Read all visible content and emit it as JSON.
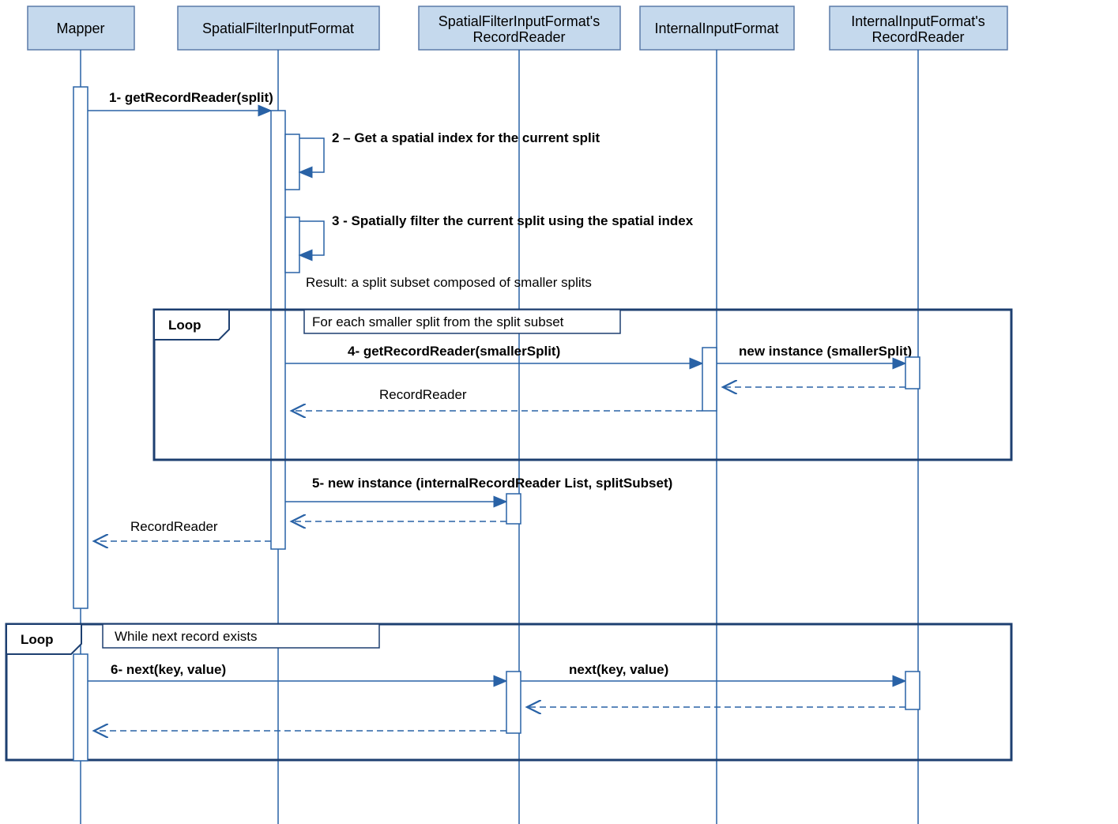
{
  "participants": {
    "p1": "Mapper",
    "p2": "SpatialFilterInputFormat",
    "p3a": "SpatialFilterInputFormat's",
    "p3b": "RecordReader",
    "p4": "InternalInputFormat",
    "p5a": "InternalInputFormat's",
    "p5b": "RecordReader"
  },
  "messages": {
    "m1": "1- getRecordReader(split)",
    "m2": "2 – Get a spatial index for the current split",
    "m3": "3 - Spatially filter the current split using the spatial index",
    "m3r": "Result: a split subset composed of smaller splits",
    "m4": "4- getRecordReader(smallerSplit)",
    "m4b": "new instance (smallerSplit)",
    "m4r": "RecordReader",
    "m5": "5- new instance (internalRecordReader List, splitSubset)",
    "m5r": "RecordReader",
    "m6": "6- next(key, value)",
    "m6b": "next(key, value)"
  },
  "loops": {
    "l1": "Loop",
    "l1g": "For each smaller split from the split subset",
    "l2": "Loop",
    "l2g": "While next record exists"
  }
}
